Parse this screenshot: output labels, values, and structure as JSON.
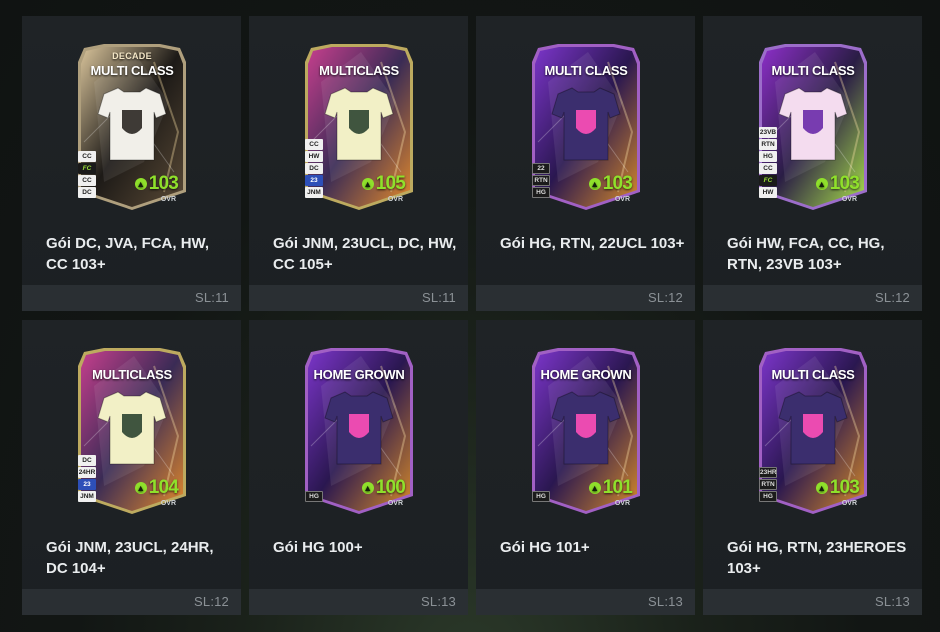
{
  "packs": [
    {
      "name": "Gói DC, JVA, FCA, HW, CC 103+",
      "stock": "SL:11",
      "card": {
        "subtitle": "DECADE",
        "title": "MULTI CLASS",
        "ovr": "103",
        "ovr_label": "OVR",
        "badges": [
          "CC",
          "FC",
          "CC",
          "DC"
        ],
        "theme": "decade",
        "icon": "dc-shirt-icon"
      }
    },
    {
      "name": "Gói JNM, 23UCL, DC, HW, CC 105+",
      "stock": "SL:11",
      "card": {
        "subtitle": "",
        "title": "MULTICLASS",
        "ovr": "105",
        "ovr_label": "OVR",
        "badges": [
          "CC",
          "HW",
          "DC",
          "23",
          "JNM"
        ],
        "theme": "jnm",
        "icon": "jnm-shirt-icon"
      }
    },
    {
      "name": "Gói HG, RTN, 22UCL 103+",
      "stock": "SL:12",
      "card": {
        "subtitle": "",
        "title": "MULTI CLASS",
        "ovr": "103",
        "ovr_label": "OVR",
        "badges": [
          "22",
          "RTN",
          "HG"
        ],
        "theme": "hg",
        "icon": "hg-shirt-icon"
      }
    },
    {
      "name": "Gói HW, FCA, CC, HG, RTN, 23VB 103+",
      "stock": "SL:12",
      "card": {
        "subtitle": "",
        "title": "MULTI CLASS",
        "ovr": "103",
        "ovr_label": "OVR",
        "badges": [
          "23VB",
          "RTN",
          "HG",
          "CC",
          "FC",
          "HW"
        ],
        "theme": "vb",
        "icon": "vb-shirt-icon"
      }
    },
    {
      "name": "Gói JNM, 23UCL, 24HR, DC 104+",
      "stock": "SL:12",
      "card": {
        "subtitle": "",
        "title": "MULTICLASS",
        "ovr": "104",
        "ovr_label": "OVR",
        "badges": [
          "DC",
          "24HR",
          "23",
          "JNM"
        ],
        "theme": "jnm",
        "icon": "jnm-shirt-icon"
      }
    },
    {
      "name": "Gói HG 100+",
      "stock": "SL:13",
      "card": {
        "subtitle": "",
        "title": "HOME GROWN",
        "ovr": "100",
        "ovr_label": "OVR",
        "badges": [
          "HG"
        ],
        "theme": "hg",
        "icon": "hg-shirt-icon"
      }
    },
    {
      "name": "Gói HG 101+",
      "stock": "SL:13",
      "card": {
        "subtitle": "",
        "title": "HOME GROWN",
        "ovr": "101",
        "ovr_label": "OVR",
        "badges": [
          "HG"
        ],
        "theme": "hg",
        "icon": "hg-shirt-icon"
      }
    },
    {
      "name": "Gói HG, RTN, 23HEROES 103+",
      "stock": "SL:13",
      "card": {
        "subtitle": "",
        "title": "MULTI CLASS",
        "ovr": "103",
        "ovr_label": "OVR",
        "badges": [
          "23HR",
          "RTN",
          "HG"
        ],
        "theme": "hg",
        "icon": "hg-shirt-icon"
      }
    }
  ],
  "colors": {
    "ovr_green": "#8fe02b",
    "tile_bg": "#1f2326",
    "footer_bg": "#2a2f33"
  }
}
